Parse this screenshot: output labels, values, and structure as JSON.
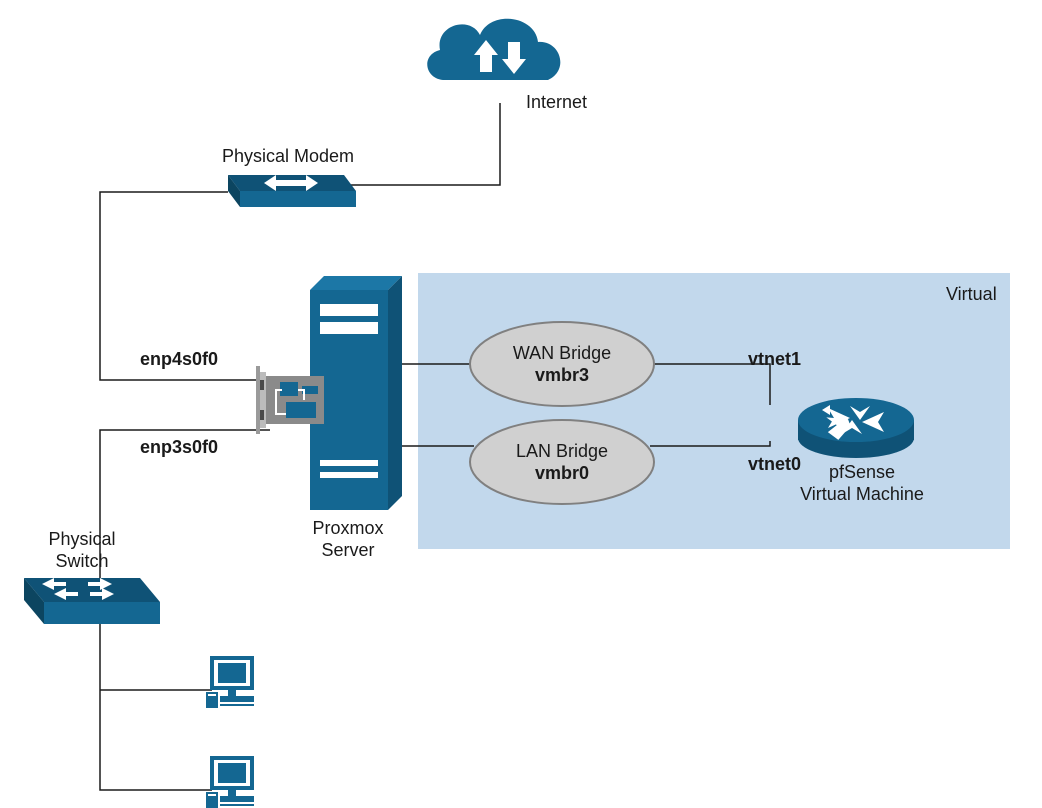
{
  "labels": {
    "internet": "Internet",
    "modem": "Physical Modem",
    "switch": "Physical Switch",
    "proxmox": "Proxmox\nServer",
    "virtual_box": "Virtual",
    "bridge_wan_1": "WAN Bridge",
    "bridge_wan_2": "vmbr3",
    "bridge_lan_1": "LAN Bridge",
    "bridge_lan_2": "vmbr0",
    "pfsense": "pfSense\nVirtual Machine",
    "enp4": "enp4s0f0",
    "enp3": "enp3s0f0",
    "vtnet1": "vtnet1",
    "vtnet0": "vtnet0"
  },
  "colors": {
    "accent": "#146792",
    "accent_dk": "#0f5276",
    "virtual_bg": "#c2d8ec",
    "bridge_fill": "#d0d0d0",
    "bridge_stroke": "#808080",
    "line": "#1a1a1a"
  }
}
